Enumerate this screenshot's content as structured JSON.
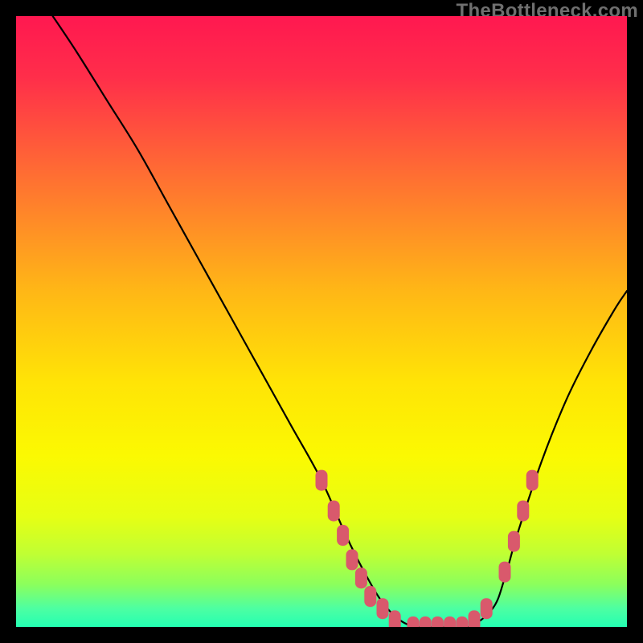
{
  "watermark": "TheBottleneck.com",
  "gradient": {
    "stops": [
      {
        "offset": 0.0,
        "color": "#ff1850"
      },
      {
        "offset": 0.1,
        "color": "#ff2e4a"
      },
      {
        "offset": 0.25,
        "color": "#ff6a34"
      },
      {
        "offset": 0.45,
        "color": "#ffb716"
      },
      {
        "offset": 0.6,
        "color": "#ffe406"
      },
      {
        "offset": 0.72,
        "color": "#fbf902"
      },
      {
        "offset": 0.82,
        "color": "#e6ff14"
      },
      {
        "offset": 0.88,
        "color": "#c0ff33"
      },
      {
        "offset": 0.93,
        "color": "#8cff5c"
      },
      {
        "offset": 0.97,
        "color": "#4dffa2"
      },
      {
        "offset": 1.0,
        "color": "#24ffb3"
      }
    ]
  },
  "chart_data": {
    "type": "line",
    "title": "",
    "xlabel": "",
    "ylabel": "",
    "xlim": [
      0,
      100
    ],
    "ylim": [
      0,
      100
    ],
    "series": [
      {
        "name": "bottleneck-curve",
        "x": [
          6,
          10,
          15,
          20,
          25,
          30,
          35,
          40,
          45,
          50,
          54,
          57,
          60,
          63,
          66,
          70,
          74,
          78,
          80,
          82,
          86,
          90,
          94,
          98,
          100
        ],
        "y": [
          100,
          94,
          86,
          78,
          69,
          60,
          51,
          42,
          33,
          24,
          15,
          9,
          4,
          1,
          0,
          0,
          0,
          3,
          8,
          15,
          27,
          37,
          45,
          52,
          55
        ]
      }
    ],
    "markers": {
      "name": "highlight-dots",
      "color": "#d9596c",
      "points": [
        {
          "x": 50,
          "y": 24
        },
        {
          "x": 52,
          "y": 19
        },
        {
          "x": 53.5,
          "y": 15
        },
        {
          "x": 55,
          "y": 11
        },
        {
          "x": 56.5,
          "y": 8
        },
        {
          "x": 58,
          "y": 5
        },
        {
          "x": 60,
          "y": 3
        },
        {
          "x": 62,
          "y": 1
        },
        {
          "x": 65,
          "y": 0
        },
        {
          "x": 67,
          "y": 0
        },
        {
          "x": 69,
          "y": 0
        },
        {
          "x": 71,
          "y": 0
        },
        {
          "x": 73,
          "y": 0
        },
        {
          "x": 75,
          "y": 1
        },
        {
          "x": 77,
          "y": 3
        },
        {
          "x": 80,
          "y": 9
        },
        {
          "x": 81.5,
          "y": 14
        },
        {
          "x": 83,
          "y": 19
        },
        {
          "x": 84.5,
          "y": 24
        }
      ]
    }
  }
}
